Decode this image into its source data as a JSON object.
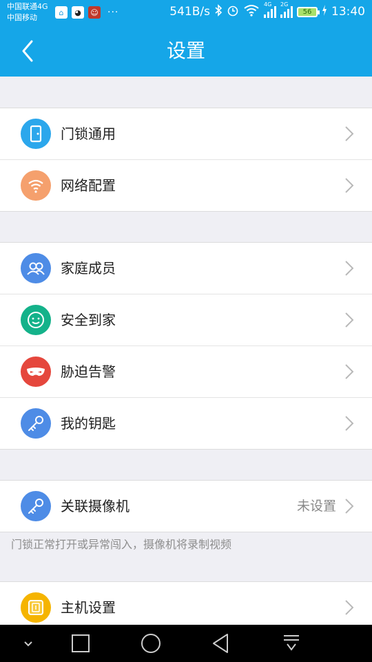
{
  "status_bar": {
    "carrier_1": "中国联通4G",
    "carrier_2": "中国移动",
    "overflow": "···",
    "net_speed": "541B/s",
    "sig1_tag": "4G",
    "sig2_tag": "2G",
    "battery": "56",
    "time": "13:40",
    "icons": [
      "home-app-icon",
      "qq-icon",
      "app-icon",
      "bluetooth-icon",
      "alarm-icon",
      "wifi-icon",
      "signal-icon",
      "signal-icon",
      "battery-icon",
      "charging-icon"
    ]
  },
  "header": {
    "title": "设置",
    "back_icon": "chevron-left-icon"
  },
  "groups": [
    {
      "rows": [
        {
          "label": "门锁通用",
          "icon": "door-icon",
          "color": "#2ca7ec"
        },
        {
          "label": "网络配置",
          "icon": "wifi-icon",
          "color": "#f5a06d"
        }
      ]
    },
    {
      "rows": [
        {
          "label": "家庭成员",
          "icon": "people-icon",
          "color": "#4e8ce6"
        },
        {
          "label": "安全到家",
          "icon": "smile-icon",
          "color": "#14b28a"
        },
        {
          "label": "胁迫告警",
          "icon": "mask-icon",
          "color": "#e5473d"
        },
        {
          "label": "我的钥匙",
          "icon": "key-icon",
          "color": "#4e8ce6"
        }
      ]
    },
    {
      "rows": [
        {
          "label": "关联摄像机",
          "value": "未设置",
          "icon": "key-icon",
          "color": "#4e8ce6"
        }
      ],
      "hint": "门锁正常打开或异常闯入，摄像机将录制视频"
    },
    {
      "rows": [
        {
          "label": "主机设置",
          "icon": "host-icon",
          "color": "#f5b400"
        }
      ]
    }
  ],
  "nav_bar": {
    "icons": [
      "hide-icon",
      "recents-icon",
      "home-icon",
      "back-icon",
      "notification-pull-icon"
    ]
  }
}
